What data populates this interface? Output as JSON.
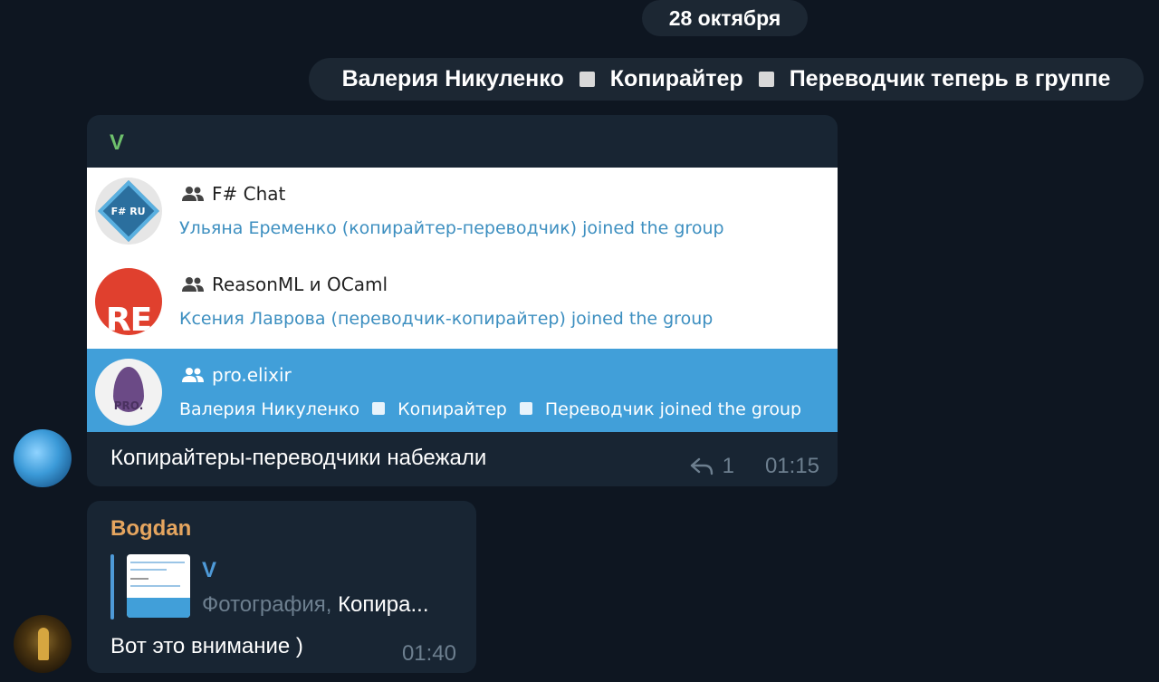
{
  "date_label": "28 октября",
  "service_message": {
    "parts": [
      "Валерия Никуленко",
      "Копирайтер",
      "Переводчик теперь в группе"
    ]
  },
  "message1": {
    "sender": "V",
    "screenshot_chats": [
      {
        "name": "F# Chat",
        "avatar_text": "F# RU",
        "line": "Ульяна Еременко (копирайтер-переводчик) joined the group"
      },
      {
        "name": "ReasonML и OCaml",
        "avatar_text": "RE",
        "line": "Ксения Лаврова (переводчик-копирайтер) joined the group"
      },
      {
        "name": "pro.elixir",
        "avatar_text": "PRO.",
        "line_parts": [
          "Валерия Никуленко",
          "Копирайтер",
          "Переводчик joined the group"
        ]
      }
    ],
    "caption": "Копирайтеры-переводчики набежали",
    "reply_count": "1",
    "time": "01:15"
  },
  "message2": {
    "sender": "Bogdan",
    "reply": {
      "author": "V",
      "kind": "Фотография, ",
      "text": "Копира..."
    },
    "caption": "Вот это внимание )",
    "time": "01:40"
  },
  "colors": {
    "background": "#0e1621",
    "bubble": "#182533",
    "pill": "#1c2733",
    "sender_v": "#6ec06c",
    "sender_bogdan": "#e5a55f",
    "accent": "#4e9ad8",
    "selected_row": "#419fd9",
    "meta": "#6d7f8f"
  },
  "icons": [
    "group-icon",
    "reply-icon"
  ]
}
